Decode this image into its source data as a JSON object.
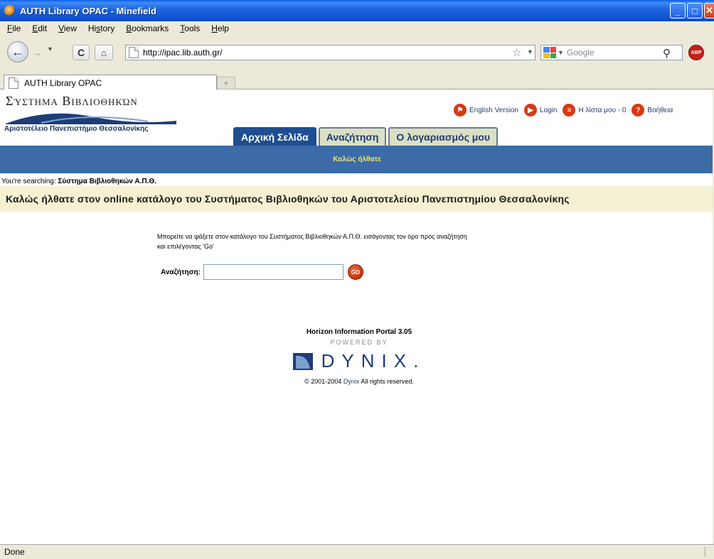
{
  "window": {
    "title": "AUTH Library OPAC - Minefield"
  },
  "menu": {
    "items": [
      {
        "accel": "F",
        "rest": "ile"
      },
      {
        "accel": "E",
        "rest": "dit"
      },
      {
        "accel": "V",
        "rest": "iew"
      },
      {
        "pre": "Hi",
        "accel": "s",
        "rest": "tory"
      },
      {
        "accel": "B",
        "rest": "ookmarks"
      },
      {
        "accel": "T",
        "rest": "ools"
      },
      {
        "accel": "H",
        "rest": "elp"
      }
    ]
  },
  "nav": {
    "url": "http://ipac.lib.auth.gr/",
    "search_placeholder": "Google",
    "abp_label": "ABP"
  },
  "tabs": {
    "active_label": "AUTH Library OPAC",
    "new_tab_symbol": "+"
  },
  "site": {
    "logo_title": "Σύστημα Βιβλιοθηκών",
    "logo_subtitle": "Αριστοτέλειο Πανεπιστήμιο Θεσσαλονίκης",
    "links": {
      "english": "English Version",
      "login": "Login",
      "mylist": "Η λίστα μου - 0",
      "help": "Βοήθεια"
    },
    "tabs": {
      "home": "Αρχική Σελίδα",
      "search": "Αναζήτηση",
      "account": "Ο λογαριασμός μου"
    },
    "welcome_small": "Καλώς ήλθατε",
    "searching_prefix": "You're searching: ",
    "searching_library": "Σύστημα Βιβλιοθηκών Α.Π.Θ.",
    "welcome_title": "Καλώς ήλθατε στον online κατάλογο του Συστήματος Βιβλιοθηκών του Αριστοτελείου Πανεπιστημίου Θεσσαλονίκης",
    "instructions_line1": "Μπορείτε να ψάξετε στον κατάλογο του Συστήματος Βιβλιοθηκών Α.Π.Θ. εισάγοντας τον όρο προς αναζήτηση",
    "instructions_line2": "και επιλέγοντας 'Go'",
    "search_label": "Αναζήτηση:",
    "search_value": "",
    "go_label": "GO"
  },
  "footer": {
    "portal": "Horizon Information Portal 3.05",
    "powered_by": "POWERED BY",
    "brand": "DYNIX.",
    "copyright_prefix": "© 2001-2004 ",
    "copyright_link": "Dynix",
    "copyright_suffix": " All rights reserved."
  },
  "status": {
    "text": "Done"
  }
}
